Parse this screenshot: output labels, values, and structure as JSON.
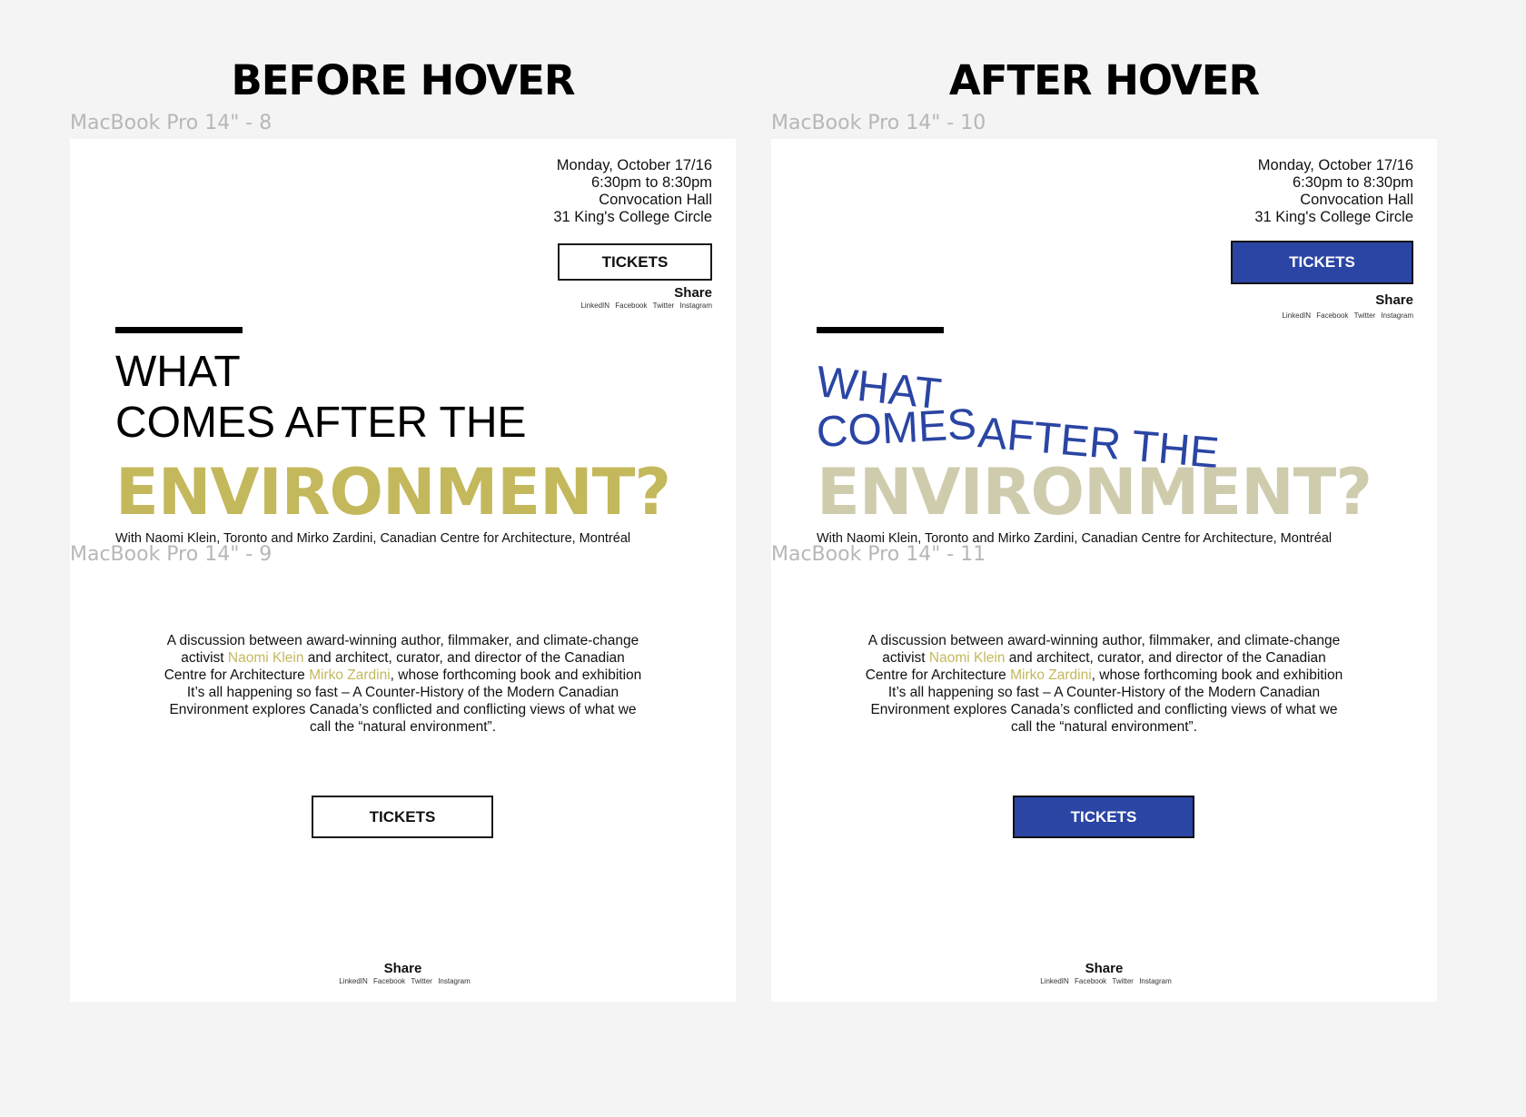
{
  "headings": {
    "before": "BEFORE HOVER",
    "after": "AFTER HOVER"
  },
  "frame_labels": {
    "f8": "MacBook Pro 14\" - 8",
    "f9": "MacBook Pro 14\" - 9",
    "f10": "MacBook Pro 14\" - 10",
    "f11": "MacBook Pro 14\" - 11"
  },
  "event": {
    "date": "Monday, October 17/16",
    "time": "6:30pm to 8:30pm",
    "venue": "Convocation Hall",
    "address": "31 King's College Circle"
  },
  "tickets_label": "TICKETS",
  "share": {
    "title": "Share",
    "links": [
      "LinkedIN",
      "Facebook",
      "Twitter",
      "Instagram"
    ]
  },
  "title": {
    "line1": "WHAT",
    "line2": "COMES AFTER THE",
    "line2_hover_a": "COMES",
    "line2_hover_b": "AFTER THE",
    "big": "ENVIRONMENT?"
  },
  "subtitle": "With Naomi Klein, Toronto and Mirko Zardini, Canadian Centre for Architecture, Montréal",
  "description": {
    "part1": "A discussion between award-winning author, filmmaker, and climate-change activist ",
    "link1": "Naomi Klein",
    "part2": " and architect, curator, and director of the Canadian Centre for Architecture ",
    "link2": "Mirko Zardini",
    "part3": ", whose forthcoming book and exhibition It’s all happening so fast – A Counter-History of the Modern Canadian Environment explores Canada’s conflicted and conflicting views of what we call the “natural environment”."
  },
  "colors": {
    "accent_gold": "#c4b85c",
    "accent_gold_faded": "#cfccae",
    "hover_blue": "#2a45a3",
    "page_bg": "#f4f4f4"
  }
}
